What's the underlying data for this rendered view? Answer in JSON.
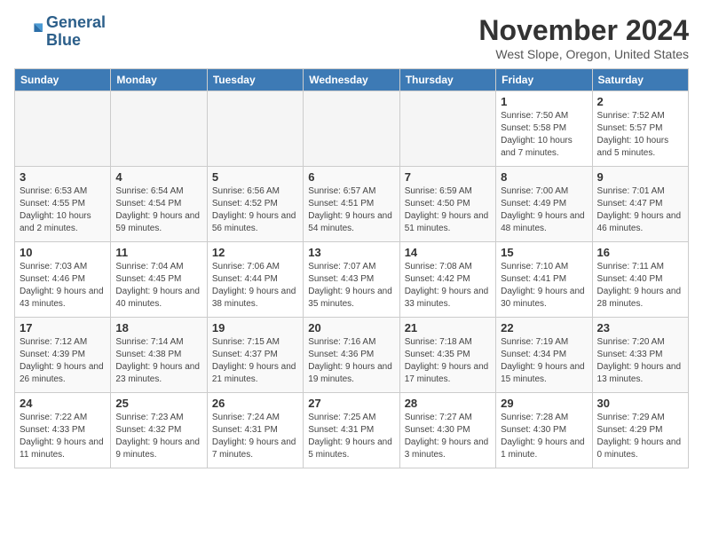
{
  "header": {
    "logo_line1": "General",
    "logo_line2": "Blue",
    "month": "November 2024",
    "location": "West Slope, Oregon, United States"
  },
  "days_of_week": [
    "Sunday",
    "Monday",
    "Tuesday",
    "Wednesday",
    "Thursday",
    "Friday",
    "Saturday"
  ],
  "weeks": [
    [
      {
        "day": "",
        "info": "",
        "empty": true
      },
      {
        "day": "",
        "info": "",
        "empty": true
      },
      {
        "day": "",
        "info": "",
        "empty": true
      },
      {
        "day": "",
        "info": "",
        "empty": true
      },
      {
        "day": "",
        "info": "",
        "empty": true
      },
      {
        "day": "1",
        "info": "Sunrise: 7:50 AM\nSunset: 5:58 PM\nDaylight: 10 hours and 7 minutes."
      },
      {
        "day": "2",
        "info": "Sunrise: 7:52 AM\nSunset: 5:57 PM\nDaylight: 10 hours and 5 minutes."
      }
    ],
    [
      {
        "day": "3",
        "info": "Sunrise: 6:53 AM\nSunset: 4:55 PM\nDaylight: 10 hours and 2 minutes."
      },
      {
        "day": "4",
        "info": "Sunrise: 6:54 AM\nSunset: 4:54 PM\nDaylight: 9 hours and 59 minutes."
      },
      {
        "day": "5",
        "info": "Sunrise: 6:56 AM\nSunset: 4:52 PM\nDaylight: 9 hours and 56 minutes."
      },
      {
        "day": "6",
        "info": "Sunrise: 6:57 AM\nSunset: 4:51 PM\nDaylight: 9 hours and 54 minutes."
      },
      {
        "day": "7",
        "info": "Sunrise: 6:59 AM\nSunset: 4:50 PM\nDaylight: 9 hours and 51 minutes."
      },
      {
        "day": "8",
        "info": "Sunrise: 7:00 AM\nSunset: 4:49 PM\nDaylight: 9 hours and 48 minutes."
      },
      {
        "day": "9",
        "info": "Sunrise: 7:01 AM\nSunset: 4:47 PM\nDaylight: 9 hours and 46 minutes."
      }
    ],
    [
      {
        "day": "10",
        "info": "Sunrise: 7:03 AM\nSunset: 4:46 PM\nDaylight: 9 hours and 43 minutes."
      },
      {
        "day": "11",
        "info": "Sunrise: 7:04 AM\nSunset: 4:45 PM\nDaylight: 9 hours and 40 minutes."
      },
      {
        "day": "12",
        "info": "Sunrise: 7:06 AM\nSunset: 4:44 PM\nDaylight: 9 hours and 38 minutes."
      },
      {
        "day": "13",
        "info": "Sunrise: 7:07 AM\nSunset: 4:43 PM\nDaylight: 9 hours and 35 minutes."
      },
      {
        "day": "14",
        "info": "Sunrise: 7:08 AM\nSunset: 4:42 PM\nDaylight: 9 hours and 33 minutes."
      },
      {
        "day": "15",
        "info": "Sunrise: 7:10 AM\nSunset: 4:41 PM\nDaylight: 9 hours and 30 minutes."
      },
      {
        "day": "16",
        "info": "Sunrise: 7:11 AM\nSunset: 4:40 PM\nDaylight: 9 hours and 28 minutes."
      }
    ],
    [
      {
        "day": "17",
        "info": "Sunrise: 7:12 AM\nSunset: 4:39 PM\nDaylight: 9 hours and 26 minutes."
      },
      {
        "day": "18",
        "info": "Sunrise: 7:14 AM\nSunset: 4:38 PM\nDaylight: 9 hours and 23 minutes."
      },
      {
        "day": "19",
        "info": "Sunrise: 7:15 AM\nSunset: 4:37 PM\nDaylight: 9 hours and 21 minutes."
      },
      {
        "day": "20",
        "info": "Sunrise: 7:16 AM\nSunset: 4:36 PM\nDaylight: 9 hours and 19 minutes."
      },
      {
        "day": "21",
        "info": "Sunrise: 7:18 AM\nSunset: 4:35 PM\nDaylight: 9 hours and 17 minutes."
      },
      {
        "day": "22",
        "info": "Sunrise: 7:19 AM\nSunset: 4:34 PM\nDaylight: 9 hours and 15 minutes."
      },
      {
        "day": "23",
        "info": "Sunrise: 7:20 AM\nSunset: 4:33 PM\nDaylight: 9 hours and 13 minutes."
      }
    ],
    [
      {
        "day": "24",
        "info": "Sunrise: 7:22 AM\nSunset: 4:33 PM\nDaylight: 9 hours and 11 minutes."
      },
      {
        "day": "25",
        "info": "Sunrise: 7:23 AM\nSunset: 4:32 PM\nDaylight: 9 hours and 9 minutes."
      },
      {
        "day": "26",
        "info": "Sunrise: 7:24 AM\nSunset: 4:31 PM\nDaylight: 9 hours and 7 minutes."
      },
      {
        "day": "27",
        "info": "Sunrise: 7:25 AM\nSunset: 4:31 PM\nDaylight: 9 hours and 5 minutes."
      },
      {
        "day": "28",
        "info": "Sunrise: 7:27 AM\nSunset: 4:30 PM\nDaylight: 9 hours and 3 minutes."
      },
      {
        "day": "29",
        "info": "Sunrise: 7:28 AM\nSunset: 4:30 PM\nDaylight: 9 hours and 1 minute."
      },
      {
        "day": "30",
        "info": "Sunrise: 7:29 AM\nSunset: 4:29 PM\nDaylight: 9 hours and 0 minutes."
      }
    ]
  ]
}
